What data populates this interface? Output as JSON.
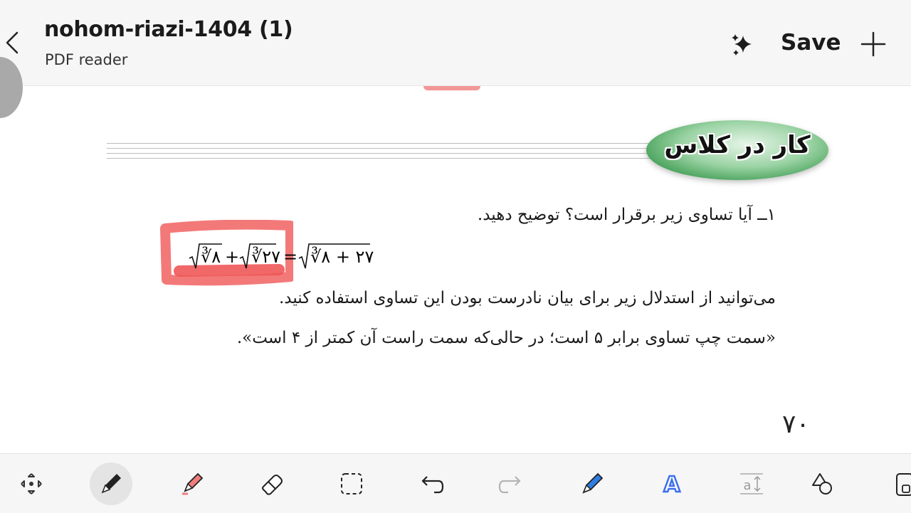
{
  "header": {
    "title": "nohom-riazi-1404 (1)",
    "subtitle": "PDF reader",
    "save_label": "Save",
    "icons": [
      "back-icon",
      "sparkle-icon",
      "plus-icon"
    ]
  },
  "document": {
    "section_badge": "کار در کلاس",
    "question_1": "۱ــ آیا تساوی زیر برقرار است؟ توضیح دهید.",
    "formula_left_1": "∛۸",
    "formula_plus": "+",
    "formula_left_2": "∛۲۷",
    "formula_equals": "=",
    "formula_right": "∛۸ + ۲۷",
    "paragraph_2": "می‌توانید از استدلال زیر برای بیان نادرست بودن این تساوی استفاده کنید.",
    "paragraph_3": "«سمت چپ تساوی برابر ۵ است؛ در حالی‌که سمت راست آن کمتر از ۴ است».",
    "page_number": "۷۰"
  },
  "toolbar": {
    "tools": [
      "move-icon",
      "pen-icon",
      "highlighter-icon",
      "eraser-icon",
      "lasso-icon",
      "undo-icon",
      "redo-icon",
      "blue-pen-icon",
      "text-style-icon",
      "text-box-icon",
      "shapes-icon",
      "more-icon"
    ],
    "active_tool": "pen-icon",
    "colors": {
      "highlight": "#f26a6a",
      "blue_pen": "#2f7de1",
      "text_style": "#3a6ff0"
    }
  }
}
